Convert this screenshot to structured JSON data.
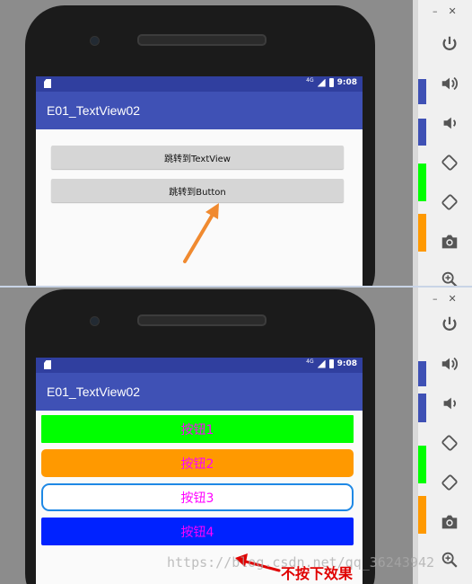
{
  "top_screen": {
    "status": {
      "network": "4G",
      "time": "9:08"
    },
    "app_title": "E01_TextView02",
    "buttons": [
      {
        "label": "跳转到TextView"
      },
      {
        "label": "跳转到Button"
      }
    ]
  },
  "bottom_screen": {
    "status": {
      "network": "4G",
      "time": "9:08"
    },
    "app_title": "E01_TextView02",
    "buttons": [
      {
        "label": "按钮1",
        "background": "#00ff00",
        "text_color": "#ff00ff"
      },
      {
        "label": "按钮2",
        "background": "#ff9900",
        "text_color": "#ff00ff"
      },
      {
        "label": "按钮3",
        "background": "#ffffff",
        "border_color": "#1e88e5",
        "text_color": "#ff00ff"
      },
      {
        "label": "按钮4",
        "background": "#0022ff",
        "text_color": "#ff00ff"
      }
    ]
  },
  "emulator_toolbar": {
    "icons": [
      "power-icon",
      "volume-up-icon",
      "volume-down-icon",
      "rotate-left-icon",
      "rotate-right-icon",
      "camera-icon",
      "zoom-icon"
    ]
  },
  "annotation": {
    "text": "不按下效果",
    "color": "#e00000"
  },
  "watermark": "https://blog.csdn.net/qq_36243942",
  "colors": {
    "status_bar": "#303f9f",
    "app_bar": "#3f51b5",
    "arrow_orange": "#f08a30",
    "arrow_red": "#e00000"
  }
}
